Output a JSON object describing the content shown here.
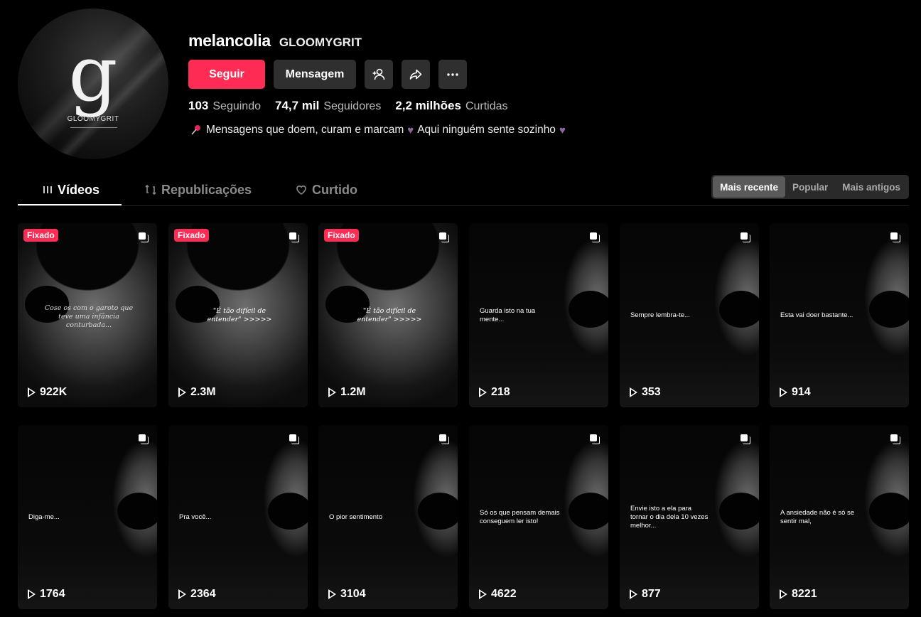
{
  "profile": {
    "avatar_glyph": "g",
    "avatar_brand": "GLOOMYGRIT",
    "username": "melancolia",
    "nickname": "GLOOMYGRIT",
    "bio_text1": "Mensagens que doem, curam e marcam",
    "bio_text2": "Aqui ninguém sente sozinho",
    "bio_icon": "pushpin-icon",
    "heart_icon": "purple-heart-icon"
  },
  "actions": {
    "follow_label": "Seguir",
    "message_label": "Mensagem",
    "add_friend_icon": "add-person-icon",
    "share_icon": "share-icon",
    "more_icon": "more-icon"
  },
  "stats": [
    {
      "value": "103",
      "label": "Seguindo"
    },
    {
      "value": "74,7 mil",
      "label": "Seguidores"
    },
    {
      "value": "2,2 milhões",
      "label": "Curtidas"
    }
  ],
  "tabs": [
    {
      "label": "Vídeos",
      "icon": "grid-icon",
      "active": true
    },
    {
      "label": "Republicações",
      "icon": "repost-icon",
      "active": false
    },
    {
      "label": "Curtido",
      "icon": "heart-outline-icon",
      "active": false
    }
  ],
  "sort": {
    "options": [
      "Mais recente",
      "Popular",
      "Mais antigos"
    ],
    "selected": "Mais recente"
  },
  "pinned_label": "Fixado",
  "videos": [
    {
      "views": "922K",
      "pinned": true,
      "caption": "Cose os com o garoto que teve uma infância conturbada..."
    },
    {
      "views": "2.3M",
      "pinned": true,
      "caption": "\"É tão difícil de entender\" >>>>>"
    },
    {
      "views": "1.2M",
      "pinned": true,
      "caption": "\"É tão difícil de entender\" >>>>>"
    },
    {
      "views": "218",
      "pinned": false,
      "caption": "Guarda isto na tua mente..."
    },
    {
      "views": "353",
      "pinned": false,
      "caption": "Sempre lembra-te..."
    },
    {
      "views": "914",
      "pinned": false,
      "caption": "Esta vai doer bastante..."
    },
    {
      "views": "1764",
      "pinned": false,
      "caption": "Diga-me..."
    },
    {
      "views": "2364",
      "pinned": false,
      "caption": "Pra você..."
    },
    {
      "views": "3104",
      "pinned": false,
      "caption": "O pior sentimento"
    },
    {
      "views": "4622",
      "pinned": false,
      "caption": "Só os que pensam demais conseguem ler isto!"
    },
    {
      "views": "877",
      "pinned": false,
      "caption": "Envie isto a ela para tornar o dia dela 10 vezes melhor..."
    },
    {
      "views": "8221",
      "pinned": false,
      "caption": "A ansiedade não é só se sentir mal,"
    }
  ],
  "colors": {
    "accent": "#fe2c55",
    "background": "#000000",
    "button_secondary": "#2f2f2f"
  }
}
